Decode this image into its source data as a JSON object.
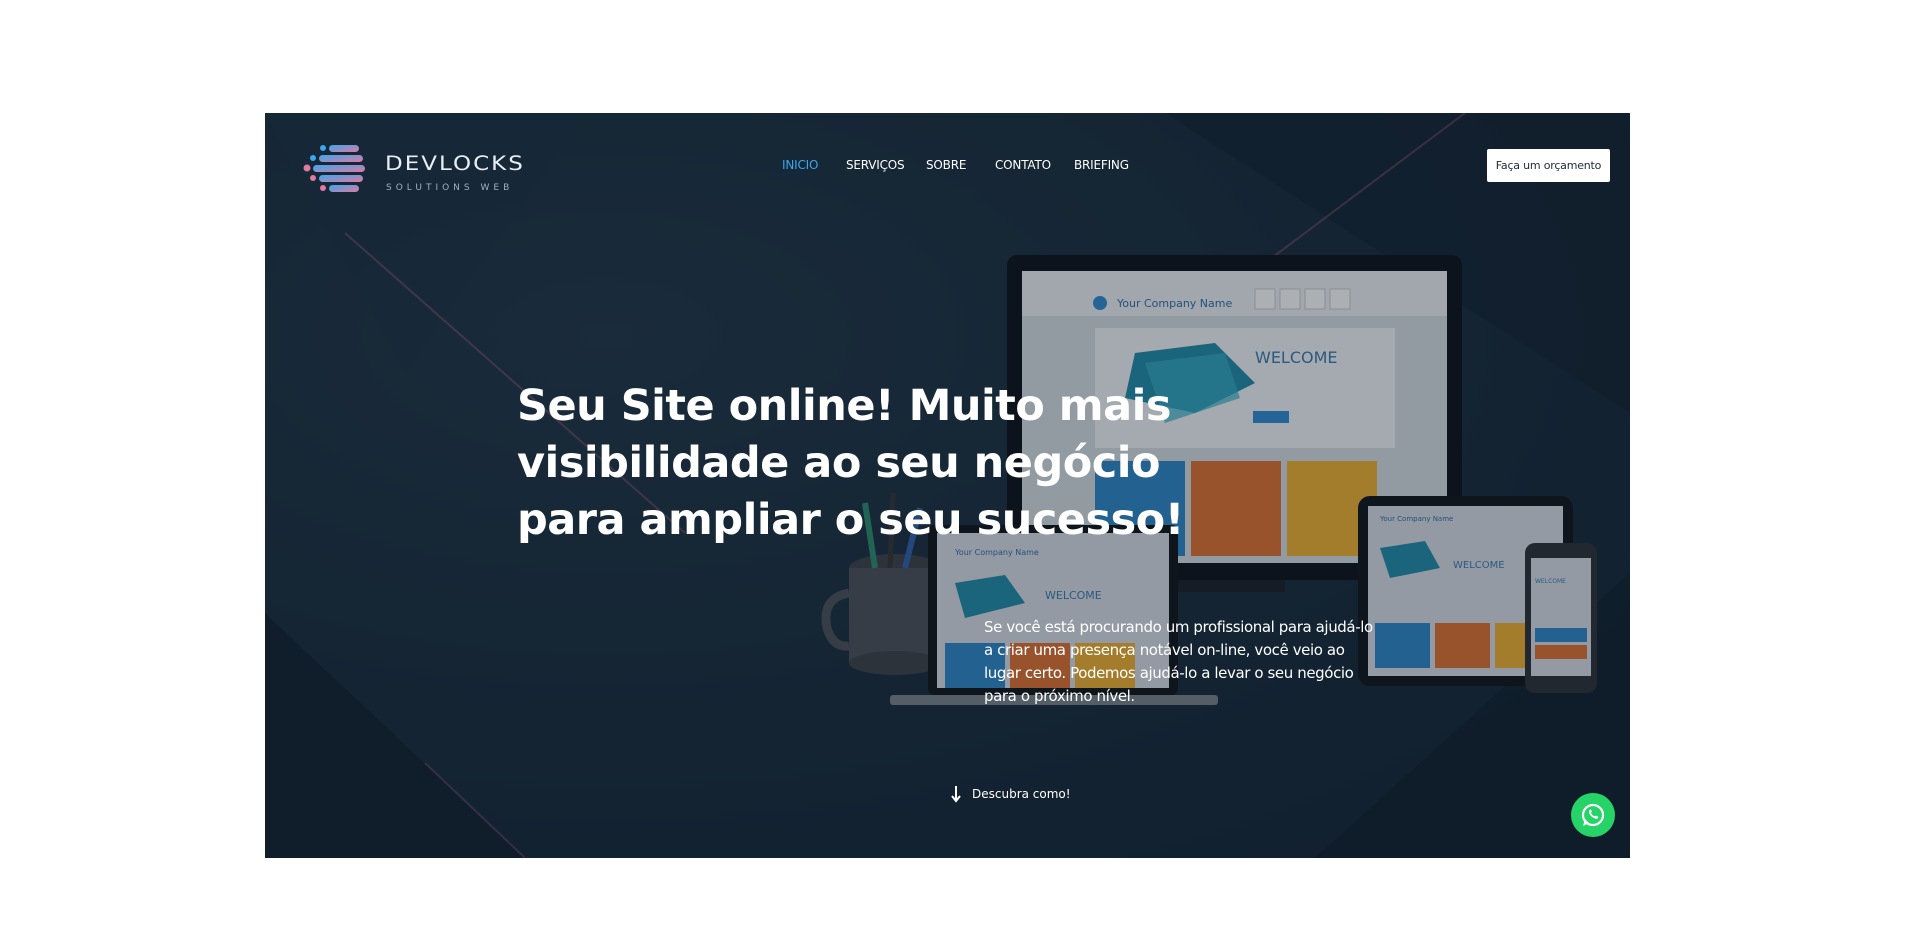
{
  "brand": {
    "name": "DEVLOCKS",
    "tagline": "SOLUTIONS WEB",
    "icon": "logo-mark"
  },
  "nav": {
    "items": [
      {
        "label": "INICIO",
        "active": true
      },
      {
        "label": "SERVIÇOS",
        "active": false
      },
      {
        "label": "SOBRE",
        "active": false
      },
      {
        "label": "CONTATO",
        "active": false
      },
      {
        "label": "BRIEFING",
        "active": false
      }
    ],
    "cta_label": "Faça um orçamento"
  },
  "hero": {
    "headline": "Seu Site online! Muito mais visibilidade ao seu negócio para ampliar o seu sucesso!",
    "lead": "Se você está procurando um profissional para ajudá-lo a criar uma presença notável on-line, você veio ao lugar certo. Podemos ajudá-lo a levar o seu negócio para o próximo nível.",
    "discover_label": "Descubra como!"
  },
  "mockup": {
    "company_name": "Your Company Name",
    "welcome": "WELCOME"
  },
  "colors": {
    "accent": "#3aa7f0",
    "background": "#172a39",
    "whatsapp": "#25d366"
  },
  "icons": [
    "arrow-down-icon",
    "whatsapp-icon"
  ]
}
